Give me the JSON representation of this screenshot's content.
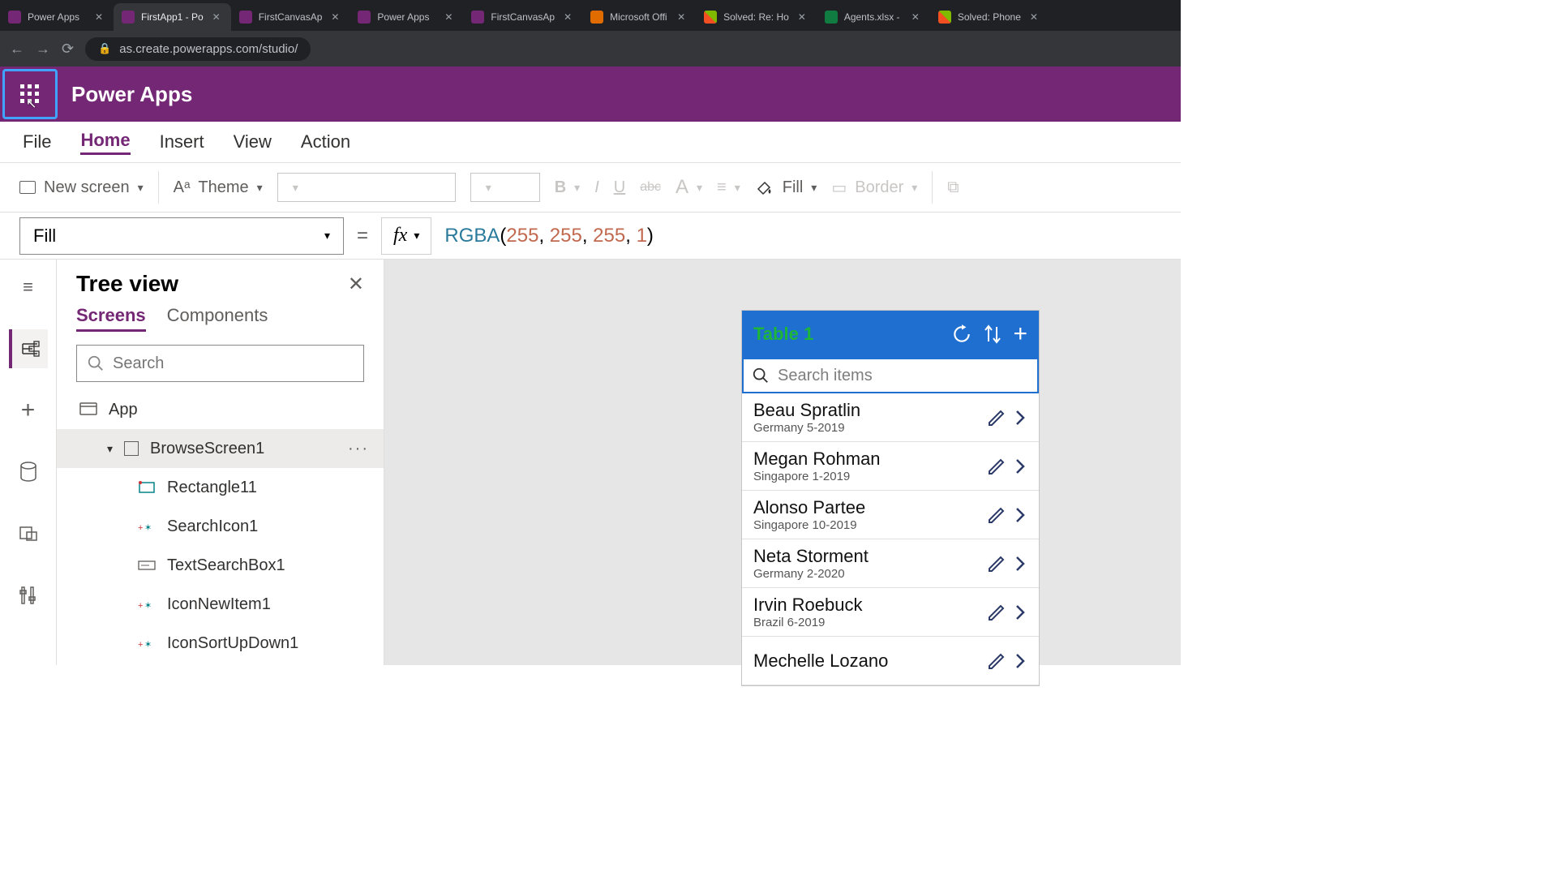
{
  "browser": {
    "tabs": [
      {
        "title": "Power Apps",
        "active": false,
        "iconClass": ""
      },
      {
        "title": "FirstApp1 - Po",
        "active": true,
        "iconClass": ""
      },
      {
        "title": "FirstCanvasAp",
        "active": false,
        "iconClass": ""
      },
      {
        "title": "Power Apps",
        "active": false,
        "iconClass": ""
      },
      {
        "title": "FirstCanvasAp",
        "active": false,
        "iconClass": ""
      },
      {
        "title": "Microsoft Offi",
        "active": false,
        "iconClass": "ms"
      },
      {
        "title": "Solved: Re: Ho",
        "active": false,
        "iconClass": "msft"
      },
      {
        "title": "Agents.xlsx - ",
        "active": false,
        "iconClass": "xl"
      },
      {
        "title": "Solved: Phone",
        "active": false,
        "iconClass": "msft"
      }
    ],
    "url": "as.create.powerapps.com/studio/"
  },
  "header": {
    "product": "Power Apps"
  },
  "menu": {
    "items": [
      "File",
      "Home",
      "Insert",
      "View",
      "Action"
    ],
    "selectedIndex": 1
  },
  "toolbar": {
    "newScreen": "New screen",
    "theme": "Theme",
    "fill": "Fill",
    "border": "Border"
  },
  "formulaBar": {
    "property": "Fill",
    "fn": "RGBA",
    "args": [
      "255",
      "255",
      "255",
      "1"
    ]
  },
  "treeView": {
    "title": "Tree view",
    "tabs": [
      "Screens",
      "Components"
    ],
    "selectedTabIndex": 0,
    "searchPlaceholder": "Search",
    "nodes": {
      "app": "App",
      "browseScreen": "BrowseScreen1",
      "children": [
        "Rectangle11",
        "SearchIcon1",
        "TextSearchBox1",
        "IconNewItem1",
        "IconSortUpDown1"
      ]
    }
  },
  "appPreview": {
    "title": "Table 1",
    "searchPlaceholder": "Search items",
    "rows": [
      {
        "name": "Beau Spratlin",
        "sub": "Germany 5-2019"
      },
      {
        "name": "Megan Rohman",
        "sub": "Singapore 1-2019"
      },
      {
        "name": "Alonso Partee",
        "sub": "Singapore 10-2019"
      },
      {
        "name": "Neta Storment",
        "sub": "Germany 2-2020"
      },
      {
        "name": "Irvin Roebuck",
        "sub": "Brazil 6-2019"
      },
      {
        "name": "Mechelle Lozano",
        "sub": ""
      }
    ]
  }
}
